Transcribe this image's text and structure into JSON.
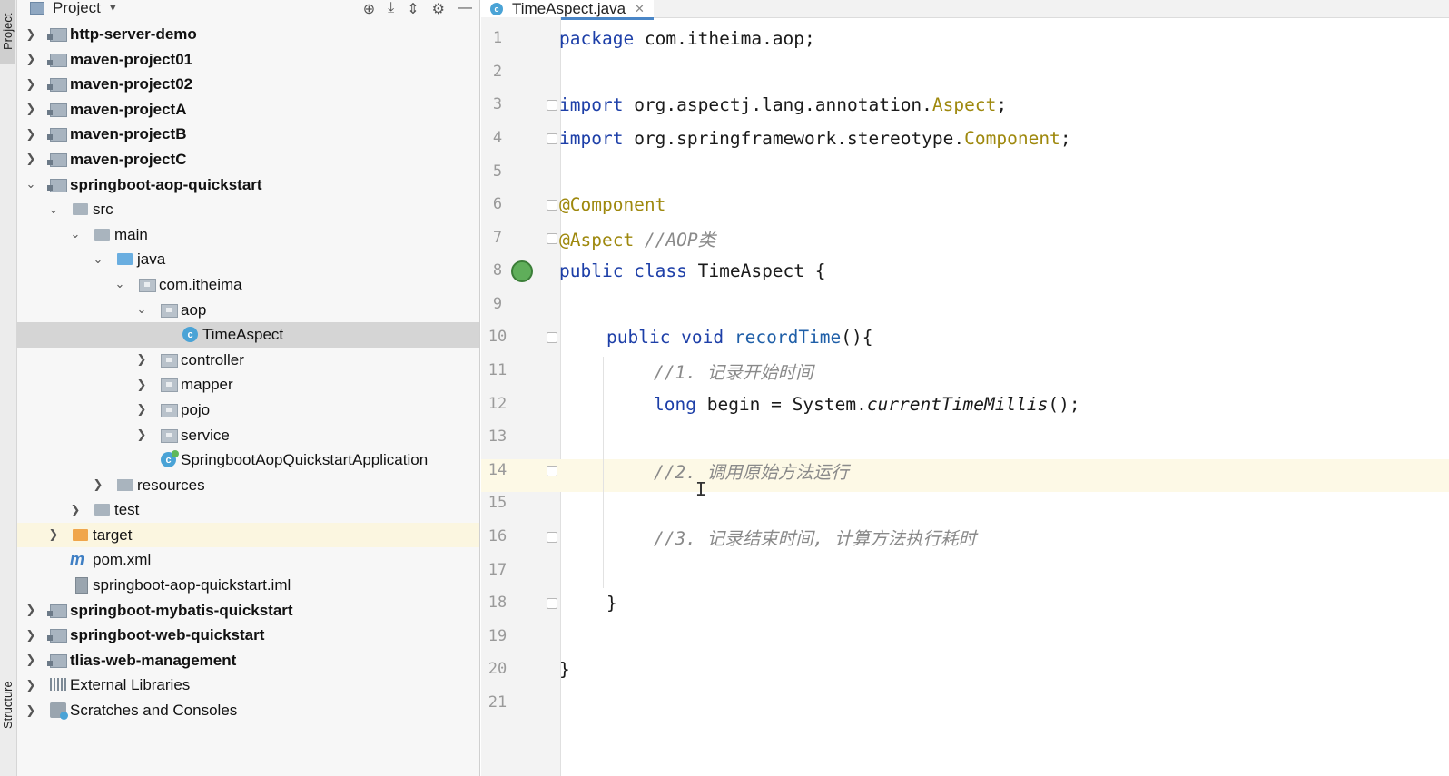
{
  "sidebar_tabs": {
    "project": "Project",
    "structure": "Structure"
  },
  "project_panel": {
    "title": "Project",
    "tree": [
      {
        "label": "http-server-demo",
        "bold": true
      },
      {
        "label": "maven-project01",
        "bold": true
      },
      {
        "label": "maven-project02",
        "bold": true
      },
      {
        "label": "maven-projectA",
        "bold": true
      },
      {
        "label": "maven-projectB",
        "bold": true
      },
      {
        "label": "maven-projectC",
        "bold": true
      },
      {
        "label": "springboot-aop-quickstart",
        "bold": true
      },
      {
        "label": "src"
      },
      {
        "label": "main"
      },
      {
        "label": "java"
      },
      {
        "label": "com.itheima"
      },
      {
        "label": "aop"
      },
      {
        "label": "TimeAspect",
        "selected": true
      },
      {
        "label": "controller"
      },
      {
        "label": "mapper"
      },
      {
        "label": "pojo"
      },
      {
        "label": "service"
      },
      {
        "label": "SpringbootAopQuickstartApplication"
      },
      {
        "label": "resources"
      },
      {
        "label": "test"
      },
      {
        "label": "target"
      },
      {
        "label": "pom.xml"
      },
      {
        "label": "springboot-aop-quickstart.iml"
      },
      {
        "label": "springboot-mybatis-quickstart",
        "bold": true
      },
      {
        "label": "springboot-web-quickstart",
        "bold": true
      },
      {
        "label": "tlias-web-management",
        "bold": true
      },
      {
        "label": "External Libraries"
      },
      {
        "label": "Scratches and Consoles"
      }
    ]
  },
  "editor": {
    "tab": {
      "label": "TimeAspect.java",
      "icon": "class-icon"
    },
    "line_numbers": [
      "1",
      "2",
      "3",
      "4",
      "5",
      "6",
      "7",
      "8",
      "9",
      "10",
      "11",
      "12",
      "13",
      "14",
      "15",
      "16",
      "17",
      "18",
      "19",
      "20",
      "21"
    ],
    "current_line": "14",
    "code": {
      "l1_kw": "package",
      "l1_rest": " com.itheima.aop;",
      "l3_kw": "import",
      "l3_pkg": " org.aspectj.lang.annotation.",
      "l3_cls": "Aspect",
      "l3_end": ";",
      "l4_kw": "import",
      "l4_pkg": " org.springframework.stereotype.",
      "l4_cls": "Component",
      "l4_end": ";",
      "l6_ann": "@Component",
      "l7_ann": "@Aspect",
      "l7_cm": " //AOP类",
      "l8_kw": "public class",
      "l8_rest": " TimeAspect {",
      "l10_kw": "public void",
      "l10_fn": " recordTime",
      "l10_rest": "(){",
      "l11_cm": "//1. 记录开始时间",
      "l12_kw": "long",
      "l12_mid": " begin = System.",
      "l12_it": "currentTimeMillis",
      "l12_end": "();",
      "l14_cm": "//2. 调用原始方法运行",
      "l16_cm": "//3. 记录结束时间, 计算方法执行耗时",
      "l18": "}",
      "l20": "}"
    }
  }
}
